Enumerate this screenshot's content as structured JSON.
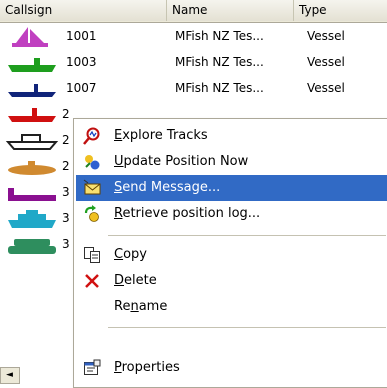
{
  "columns": {
    "callsign": "Callsign",
    "name": "Name",
    "type": "Type"
  },
  "rows": [
    {
      "callsign": "1001",
      "name": "MFish NZ Tes...",
      "type": "Vessel",
      "icon": "sailboat-icon",
      "color": "#c040c0"
    },
    {
      "callsign": "1003",
      "name": "MFish NZ Tes...",
      "type": "Vessel",
      "icon": "ship-icon",
      "color": "#1e9e1e"
    },
    {
      "callsign": "1007",
      "name": "MFish NZ Tes...",
      "type": "Vessel",
      "icon": "ship-icon",
      "color": "#10247a"
    }
  ],
  "hidden_rows": [
    {
      "callsign": "2",
      "icon": "ship-icon",
      "color": "#d01010"
    },
    {
      "callsign": "2",
      "icon": "boat-outline-icon",
      "color": "#202020"
    },
    {
      "callsign": "2",
      "icon": "submarine-icon",
      "color": "#d08a30"
    },
    {
      "callsign": "3",
      "icon": "barge-icon",
      "color": "#8a1090"
    },
    {
      "callsign": "3",
      "icon": "cruise-ship-icon",
      "color": "#20a8c8"
    },
    {
      "callsign": "3",
      "icon": "ferry-icon",
      "color": "#2e8e5e"
    }
  ],
  "menu": {
    "explore_tracks": {
      "pre": "",
      "ul": "E",
      "post": "xplore Tracks"
    },
    "update_position": {
      "pre": "",
      "ul": "U",
      "post": "pdate Position Now"
    },
    "send_message": {
      "pre": "",
      "ul": "S",
      "post": "end Message..."
    },
    "retrieve_log": {
      "pre": "",
      "ul": "R",
      "post": "etrieve position log..."
    },
    "copy": {
      "pre": "",
      "ul": "C",
      "post": "opy"
    },
    "delete": {
      "pre": "",
      "ul": "D",
      "post": "elete"
    },
    "rename": {
      "pre": "Re",
      "ul": "n",
      "post": "ame"
    },
    "properties": {
      "pre": "",
      "ul": "P",
      "post": "roperties"
    }
  },
  "scroll_left_glyph": "◄"
}
